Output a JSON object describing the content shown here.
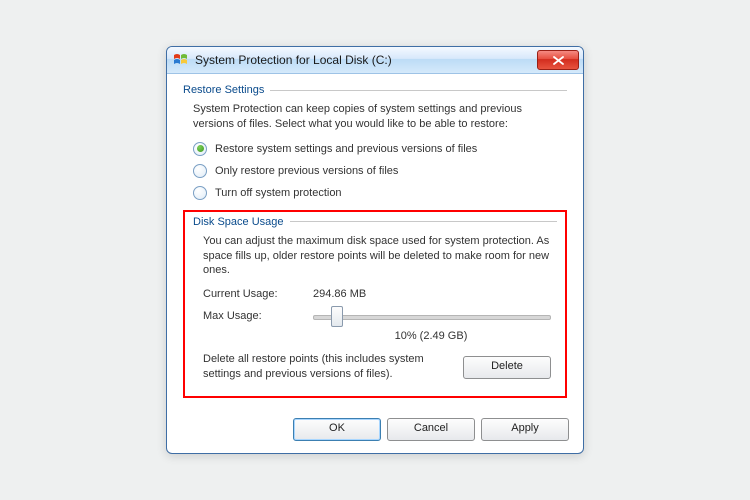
{
  "window": {
    "title": "System Protection for Local Disk (C:)"
  },
  "restore": {
    "legend": "Restore Settings",
    "description": "System Protection can keep copies of system settings and previous versions of files. Select what you would like to be able to restore:",
    "options": {
      "opt1": "Restore system settings and previous versions of files",
      "opt2": "Only restore previous versions of files",
      "opt3": "Turn off system protection"
    },
    "selected": "opt1"
  },
  "disk": {
    "legend": "Disk Space Usage",
    "description": "You can adjust the maximum disk space used for system protection. As space fills up, older restore points will be deleted to make room for new ones.",
    "currentUsageLabel": "Current Usage:",
    "currentUsageValue": "294.86 MB",
    "maxUsageLabel": "Max Usage:",
    "sliderPercent": 10,
    "sliderCaption": "10% (2.49 GB)",
    "deleteText": "Delete all restore points (this includes system settings and previous versions of files).",
    "deleteButton": "Delete"
  },
  "footer": {
    "ok": "OK",
    "cancel": "Cancel",
    "apply": "Apply"
  }
}
